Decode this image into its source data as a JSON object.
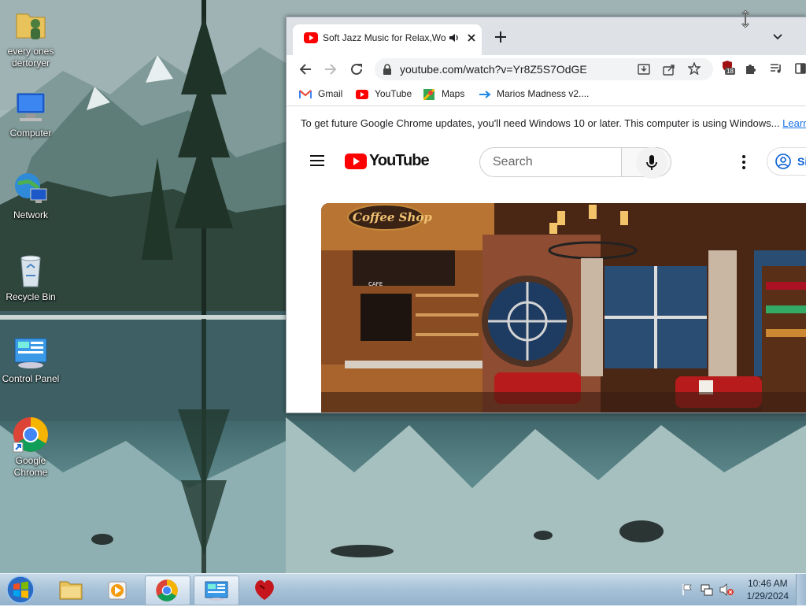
{
  "desktop": {
    "icons": [
      {
        "label": "every ones dertoryer",
        "icon": "user-folder-icon"
      },
      {
        "label": "Computer",
        "icon": "computer-icon"
      },
      {
        "label": "Network",
        "icon": "network-icon"
      },
      {
        "label": "Recycle Bin",
        "icon": "recycle-bin-icon"
      },
      {
        "label": "Control Panel",
        "icon": "control-panel-icon"
      },
      {
        "label": "Google Chrome",
        "icon": "chrome-icon"
      }
    ]
  },
  "browser": {
    "tab": {
      "title": "Soft Jazz Music for Relax,Wo",
      "favicon": "youtube-favicon-icon",
      "audio": "speaker-icon"
    },
    "url": "youtube.com/watch?v=Yr8Z5S7OdGE",
    "extension_badge": "18",
    "bookmarks": [
      {
        "label": "Gmail",
        "icon": "gmail-icon"
      },
      {
        "label": "YouTube",
        "icon": "youtube-icon"
      },
      {
        "label": "Maps",
        "icon": "maps-icon"
      },
      {
        "label": "Marios Madness v2....",
        "icon": "arrow-bookmark-icon"
      }
    ],
    "infobar": {
      "text": "To get future Google Chrome updates, you'll need Windows 10 or later. This computer is using Windows...",
      "link": "Learn"
    }
  },
  "youtube": {
    "logo_text": "YouTube",
    "search_placeholder": "Search",
    "signin_label": "Si",
    "thumbnail": {
      "sign": "Coffee Shop",
      "menu_sign": "CAFE"
    }
  },
  "taskbar": {
    "time": "10:46 AM",
    "date": "1/29/2024"
  },
  "colors": {
    "youtube_red": "#ff0000",
    "chrome_link": "#1a73e8",
    "taskbar": "#a9c3d8"
  }
}
